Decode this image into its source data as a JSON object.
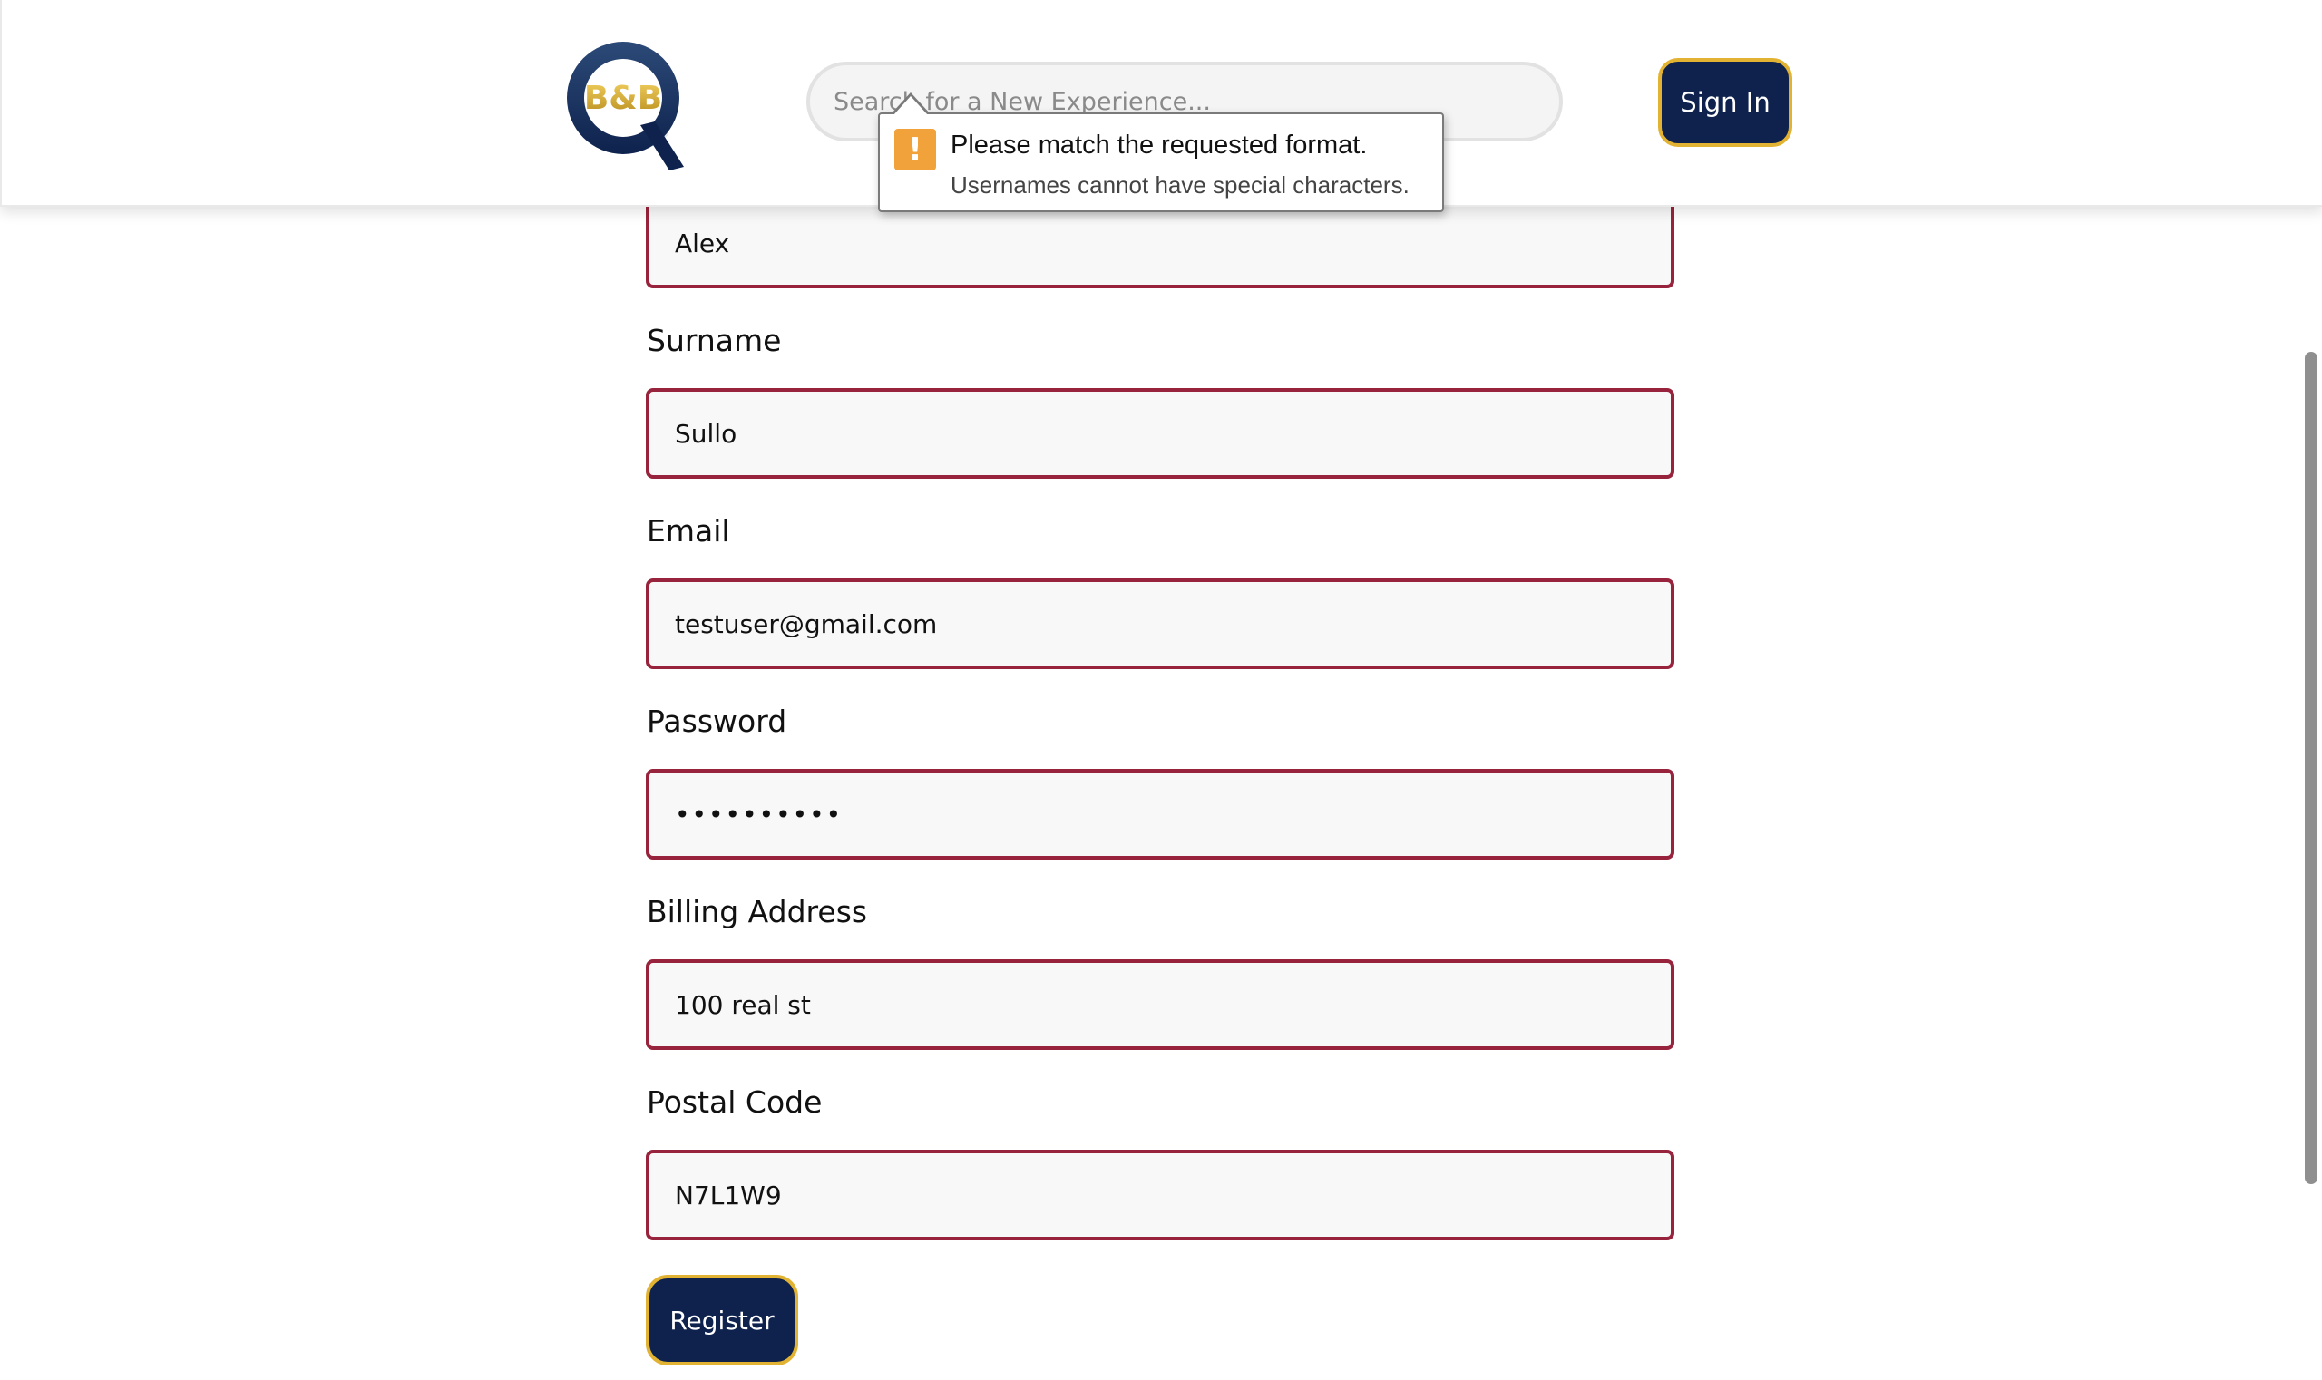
{
  "header": {
    "logo_text": "B&B",
    "search_placeholder": "Search for a New Experience...",
    "signin_label": "Sign In"
  },
  "validation_tooltip": {
    "icon": "warning-icon",
    "title": "Please match the requested format.",
    "message": "Usernames cannot have special characters."
  },
  "form": {
    "first_name": {
      "value": "Alex"
    },
    "surname": {
      "label": "Surname",
      "value": "Sullo"
    },
    "email": {
      "label": "Email",
      "value": "testuser@gmail.com"
    },
    "password": {
      "label": "Password",
      "value": "••••••••••"
    },
    "billing_address": {
      "label": "Billing Address",
      "value": "100 real st"
    },
    "postal_code": {
      "label": "Postal Code",
      "value": "N7L1W9"
    },
    "register_label": "Register"
  },
  "colors": {
    "navy": "#0e224d",
    "gold": "#e2b332",
    "input_border": "#98233c",
    "warning": "#f2a23a"
  }
}
